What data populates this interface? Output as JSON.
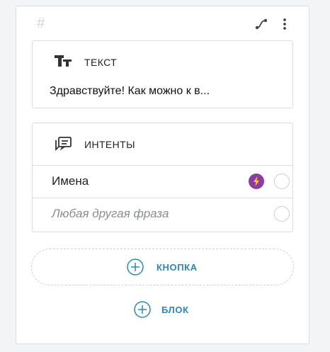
{
  "card": {
    "hash_symbol": "#"
  },
  "text_block": {
    "title": "Текст",
    "icon": "text-type-icon",
    "value": "Здравствуйте! Как можно к в..."
  },
  "intents_block": {
    "title": "Интенты",
    "icon": "chat-list-icon",
    "items": [
      {
        "label": "Имена",
        "italic": false,
        "badge_icon": "lightning-icon"
      },
      {
        "label": "Любая другая фраза",
        "italic": true
      }
    ]
  },
  "actions": {
    "add_button_label": "КНОПКА",
    "add_block_label": "БЛОК"
  },
  "colors": {
    "accent": "#2c88b5",
    "badge": "#8b3d9f",
    "border": "#dcdde0"
  }
}
